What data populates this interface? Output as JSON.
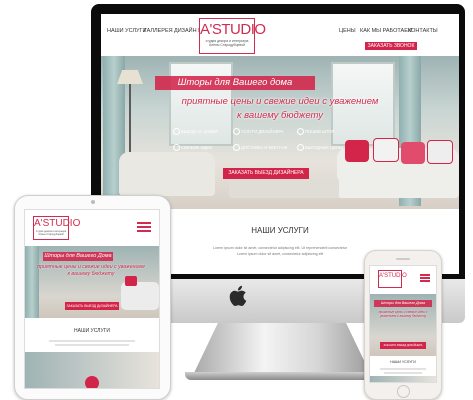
{
  "desktop": {
    "nav": {
      "services": "НАШИ УСЛУГИ",
      "gallery": "ГАЛЛЕРЕЯ",
      "interior_design": "ДИЗАЙН ИНТЕРЬЕРОВ",
      "prices": "ЦЕНЫ",
      "how_we_work": "КАК МЫ РАБОТАЕМ",
      "contacts": "КОНТАКТЫ",
      "call_button": "ЗАКАЗАТЬ ЗВОНОК"
    },
    "logo": {
      "text": "A'STUDIO",
      "subtitle": "студия декора и интерьера Алёны Стародубцевой"
    },
    "hero": {
      "title": "Шторы для Вашего дома",
      "subtitle_line1": "приятные цены и свежие идеи с уважением",
      "subtitle_line2": "к вашему бюджету",
      "features": [
        "ВЫЕЗД НА ЗАМЕР",
        "УСЛУГИ ДИЗАЙНЕРА",
        "ПОШИВ ШТОР",
        "СВЕЖИЕ ИДЕИ",
        "ДОСТАВКА И МОНТАЖ",
        "ВЫГОДНЫЕ ЦЕНЫ"
      ],
      "cta": "ЗАКАЗАТЬ ВЫЕЗД ДИЗАЙНЕРА"
    },
    "services": {
      "title": "НАШИ УСЛУГИ",
      "lorem_line1": "Lorem ipsum dolor sit amet, consectetur adipiscing elit. Ut reprehenderit consectetur",
      "lorem_line2": "Lorem ipsum dolor sit amet, consectetur adipiscing elit"
    }
  },
  "tablet": {
    "logo": "A'STUDIO",
    "logo_sub": "студия декора и интерьера Алёны Стародубцевой",
    "hero_title": "Шторы для Вашего Дома",
    "hero_sub1": "приятные цены и свежие идеи с уважением",
    "hero_sub2": "к вашему бюджету",
    "cta": "ЗАКАЗАТЬ ВЫЕЗД ДИЗАЙНЕРА",
    "services_title": "НАШИ УСЛУГИ"
  },
  "phone": {
    "logo": "A'STUDIO",
    "hero_title": "Шторы для Вашего Дома",
    "hero_sub": "приятные цены и свежие идеи с уважением к вашему бюджету",
    "cta": "ЗАКАЗАТЬ ВЫЕЗД ДИЗАЙНЕРА",
    "services_title": "НАШИ УСЛУГИ"
  },
  "colors": {
    "accent": "#d3244a",
    "bezel": "#0b0b0b"
  },
  "icons": {
    "apple_logo": "apple-icon"
  }
}
